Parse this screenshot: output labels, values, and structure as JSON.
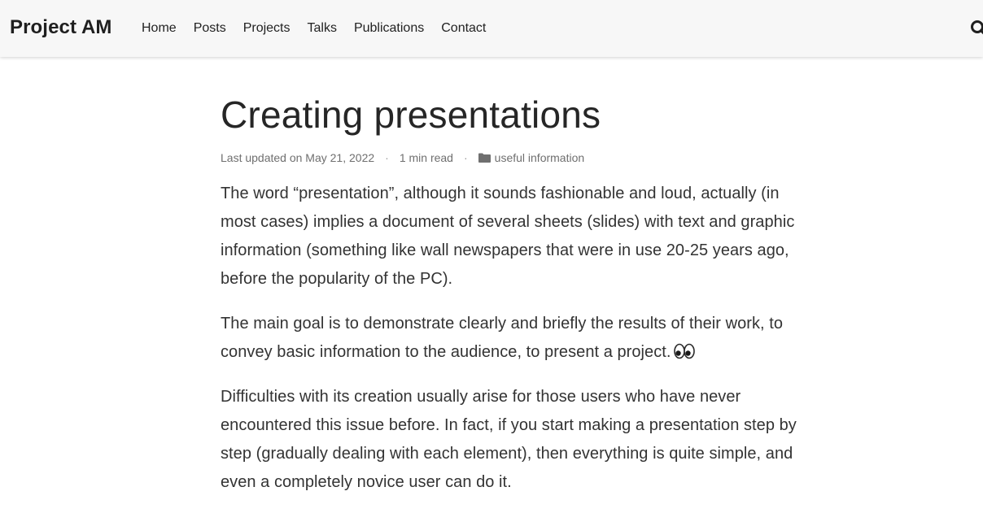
{
  "navbar": {
    "brand": "Project AM",
    "links": [
      {
        "label": "Home"
      },
      {
        "label": "Posts"
      },
      {
        "label": "Projects"
      },
      {
        "label": "Talks"
      },
      {
        "label": "Publications"
      },
      {
        "label": "Contact"
      }
    ],
    "search_icon": "search-icon"
  },
  "article": {
    "title": "Creating presentations",
    "meta": {
      "updated": "Last updated on May 21, 2022",
      "separator": "·",
      "read_time": "1 min read",
      "category_icon": "folder-icon",
      "category": "useful information"
    },
    "paragraphs": [
      "The word “presentation”, although it sounds fashionable and loud, actually (in most cases) implies a document of several sheets (slides) with text and graphic information (something like wall newspapers that were in use 20-25 years ago, before the popularity of the PC).",
      "The main goal is to demonstrate clearly and briefly the results of their work, to convey basic information to the audience, to present a project.",
      "Difficulties with its creation usually arise for those users who have never encountered this issue before. In fact, if you start making a presentation step by step (gradually dealing with each element), then everything is quite simple, and even a completely novice user can do it."
    ],
    "emoji_icon": "eyes-icon"
  }
}
